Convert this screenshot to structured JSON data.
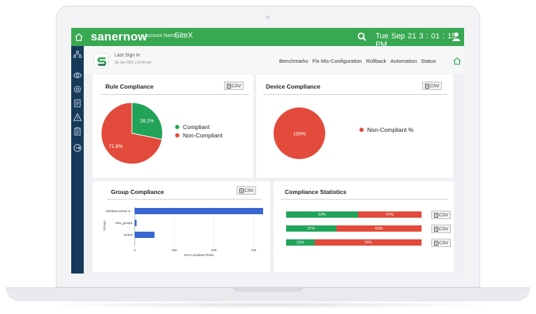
{
  "header": {
    "brand": "sanernow",
    "account_label": "Account Name",
    "account_value": "SiteX",
    "datetime": "Tue Sep 21  3 : 01 : 15 PM"
  },
  "signin": {
    "label": "Last Sign in",
    "date": "18-Jan-2021 | 10:00 am"
  },
  "nav": {
    "items": [
      "Benchmarks",
      "Fix Mis-Configuration",
      "Rollback",
      "Automation",
      "Status"
    ]
  },
  "colors": {
    "green": "#22a35a",
    "red": "#e24b3b",
    "blue": "#3a66d1",
    "topbar": "#39a852",
    "sidebar": "#163a5a"
  },
  "rule_compliance": {
    "title": "Rule Compliance",
    "csv_label": "CSV",
    "legend": [
      "Compliant",
      "Non-Compliant"
    ]
  },
  "device_compliance": {
    "title": "Device Compliance",
    "csv_label": "CSV",
    "legend": [
      "Non-Compliant %"
    ]
  },
  "group_compliance": {
    "title": "Group Compliance",
    "csv_label": "CSV"
  },
  "compliance_statistics": {
    "title": "Compliance Statistics",
    "csv_label": "CSV"
  },
  "chart_data": [
    {
      "type": "pie",
      "title": "Rule Compliance",
      "categories": [
        "Compliant",
        "Non-Compliant"
      ],
      "values": [
        28.2,
        71.8
      ],
      "labels": [
        "28.2%",
        "71.8%"
      ]
    },
    {
      "type": "pie",
      "title": "Device Compliance",
      "categories": [
        "Non-Compliant %"
      ],
      "values": [
        100
      ],
      "labels": [
        "100%"
      ]
    },
    {
      "type": "bar",
      "orientation": "horizontal",
      "title": "Group Compliance",
      "categories": [
        "windows server 2...",
        "new_group1",
        "centos"
      ],
      "values": [
        810,
        12,
        125
      ],
      "xlabel": "Non-Compliant Rules",
      "ylabel": "Groups",
      "xticks": [
        0,
        250,
        500,
        750
      ],
      "xlim": [
        0,
        810
      ],
      "grid": true
    },
    {
      "type": "bar",
      "orientation": "stacked-horizontal",
      "title": "Compliance Statistics",
      "rows": [
        {
          "green": 53,
          "red": 47,
          "green_label": "53%",
          "red_label": "47%"
        },
        {
          "green": 37,
          "red": 63,
          "green_label": "37%",
          "red_label": "63%"
        },
        {
          "green": 21,
          "red": 79,
          "green_label": "21%",
          "red_label": "79%"
        }
      ]
    }
  ]
}
